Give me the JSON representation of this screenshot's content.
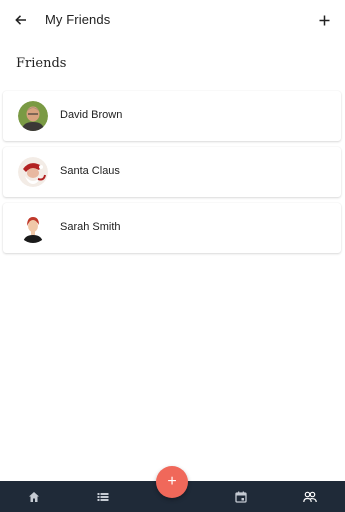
{
  "appbar": {
    "title": "My Friends",
    "back_icon": "arrow-left-icon",
    "add_icon": "plus-icon"
  },
  "section": {
    "title": "Friends"
  },
  "friends": [
    {
      "name": "David Brown",
      "avatar": "avatar-david-brown"
    },
    {
      "name": "Santa Claus",
      "avatar": "avatar-santa-claus"
    },
    {
      "name": "Sarah Smith",
      "avatar": "avatar-sarah-smith"
    }
  ],
  "fab": {
    "label": "+",
    "color": "#f0685a"
  },
  "bottom_nav": {
    "background": "#1f2a38",
    "items": [
      {
        "icon": "home-icon",
        "active": false
      },
      {
        "icon": "list-icon",
        "active": false
      },
      {
        "icon": "calendar-icon",
        "active": false
      },
      {
        "icon": "people-icon",
        "active": true
      }
    ]
  }
}
